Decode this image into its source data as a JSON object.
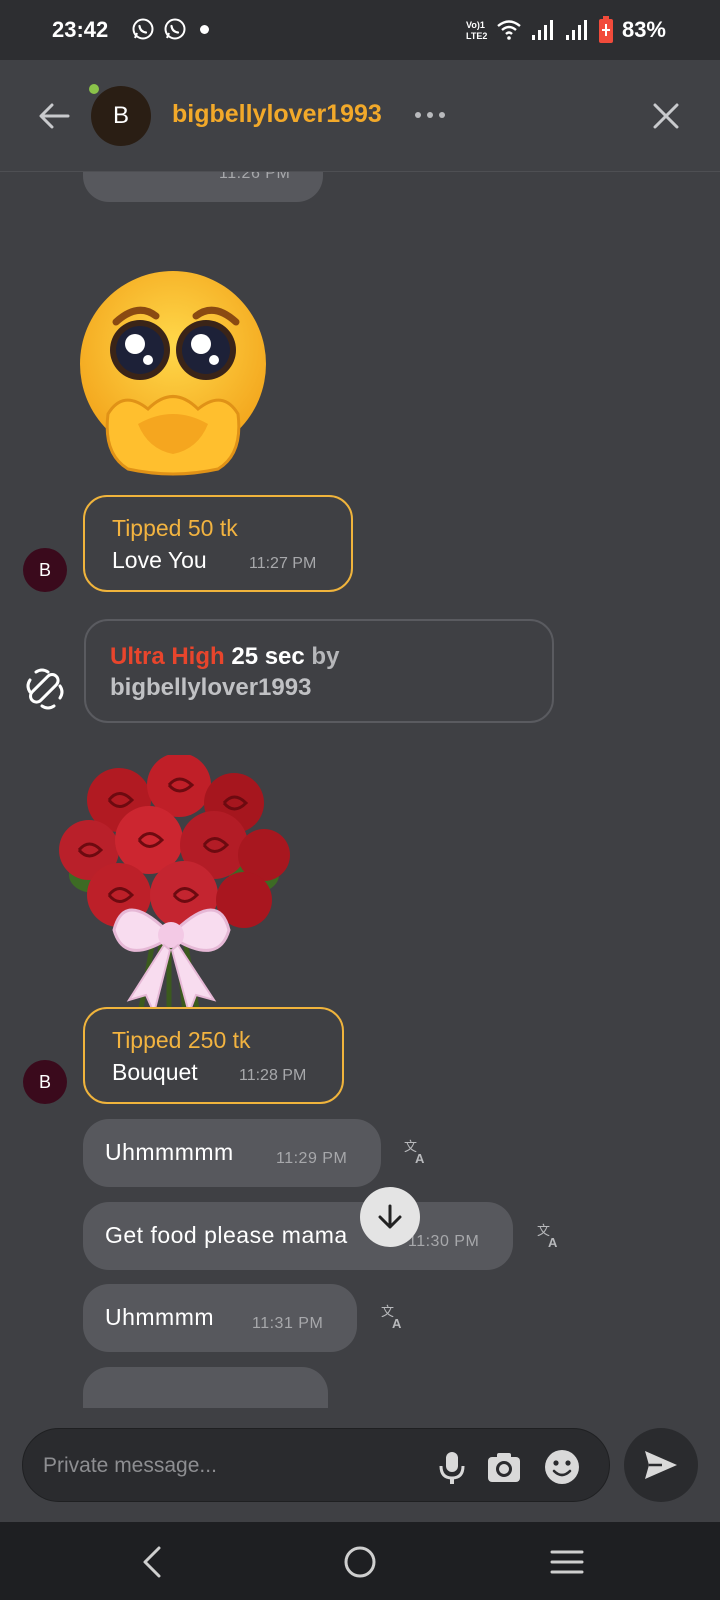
{
  "status_bar": {
    "time": "23:42",
    "network_label": "Vo) LTE2",
    "battery": "83%"
  },
  "header": {
    "avatar_letter": "B",
    "username": "bigbellylover1993"
  },
  "messages": {
    "cutoff_time": "11:26 PM",
    "tip1": {
      "title": "Tipped 50 tk",
      "text": "Love You",
      "time": "11:27 PM",
      "avatar": "B"
    },
    "ultra": {
      "level": "Ultra High",
      "duration": "25 sec",
      "by": "by",
      "user": "bigbellylover1993"
    },
    "tip2": {
      "title": "Tipped 250 tk",
      "text": "Bouquet",
      "time": "11:28 PM",
      "avatar": "B"
    },
    "msg1": {
      "text": "Uhmmmmm",
      "time": "11:29 PM"
    },
    "msg2": {
      "text": "Get food please mama",
      "time": "11:30 PM"
    },
    "msg3": {
      "text": "Uhmmmm",
      "time": "11:31 PM"
    }
  },
  "input": {
    "placeholder": "Private message..."
  },
  "colors": {
    "accent": "#f2a92a",
    "tip_border": "#f0b43c",
    "ultra_red": "#e8452c",
    "bubble": "#57585d",
    "background": "#3f4044"
  },
  "icons": [
    "back-arrow-icon",
    "more-icon",
    "close-icon",
    "translate-icon",
    "vibration-icon",
    "scroll-down-icon",
    "mic-icon",
    "camera-icon",
    "emoji-icon",
    "send-icon",
    "nav-back-icon",
    "nav-home-icon",
    "nav-menu-icon",
    "whatsapp-icon",
    "wifi-icon",
    "signal-icon",
    "battery-icon"
  ]
}
